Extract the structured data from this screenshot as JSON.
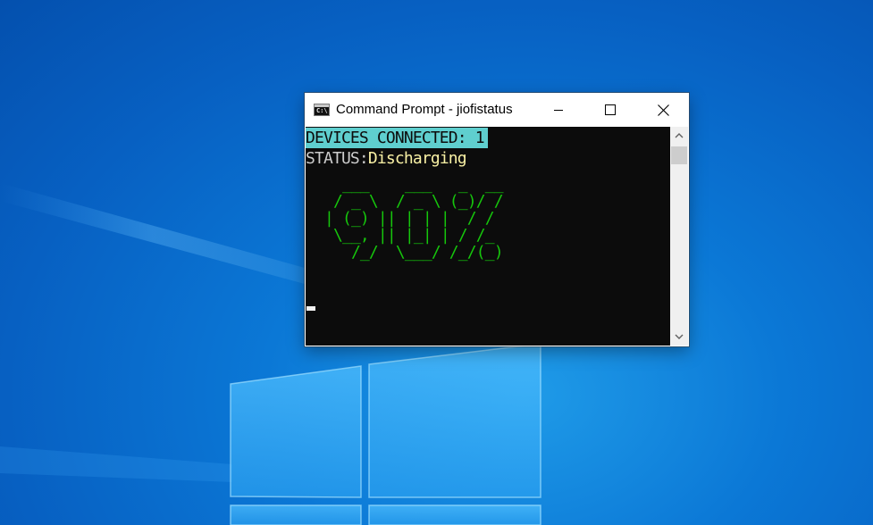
{
  "window": {
    "title": "Command Prompt - jiofistatus",
    "icon": "console-icon",
    "icon_glyph": "C:\\"
  },
  "console": {
    "devices_line": "DEVICES CONNECTED: 1",
    "status_label": "STATUS:",
    "status_value": "Discharging",
    "battery_art": "   ___    ___   _  __\n  / _ \\  / _ \\ (_)/ /\n | (_) || | | |  / / \n  \\__, || |_| | / /_ \n    /_/  \\___/ /_/(_)",
    "battery_percent": 0.9,
    "colors": {
      "background": "#0c0c0c",
      "highlight_bg": "#5fcfcf",
      "status_label": "#cccccc",
      "status_value": "#f9f1a5",
      "art": "#16c60c"
    }
  },
  "controls": {
    "minimize_icon": "minimize-icon",
    "maximize_icon": "maximize-icon",
    "close_icon": "close-icon",
    "scroll_up_icon": "chevron-up-icon",
    "scroll_down_icon": "chevron-down-icon"
  },
  "desktop": {
    "background_color": "#0a6fd1",
    "logo": "windows-logo"
  }
}
